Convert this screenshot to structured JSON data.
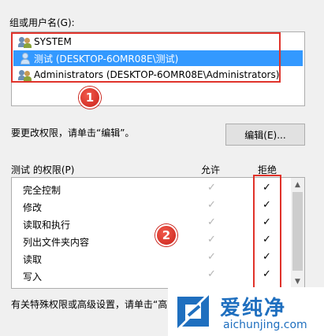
{
  "group_label": "组或用户名(G):",
  "users": [
    {
      "name": "SYSTEM",
      "icon": "group-icon",
      "selected": false
    },
    {
      "name": "测试 (DESKTOP-6OMR08E\\测试)",
      "icon": "user-icon",
      "selected": true
    },
    {
      "name": "Administrators (DESKTOP-6OMR08E\\Administrators)",
      "icon": "group-icon",
      "selected": false
    }
  ],
  "annotations": {
    "badge1": "1",
    "badge2": "2",
    "color": "#e0322a"
  },
  "change_hint": "要更改权限，请单击“编辑”。",
  "edit_button": "编辑(E)...",
  "permissions": {
    "title": "测试 的权限(P)",
    "col_allow": "允许",
    "col_deny": "拒绝",
    "rows": [
      {
        "name": "完全控制",
        "allow": "✓",
        "deny": "✓"
      },
      {
        "name": "修改",
        "allow": "✓",
        "deny": "✓"
      },
      {
        "name": "读取和执行",
        "allow": "✓",
        "deny": "✓"
      },
      {
        "name": "列出文件夹内容",
        "allow": "✓",
        "deny": "✓"
      },
      {
        "name": "读取",
        "allow": "✓",
        "deny": "✓"
      },
      {
        "name": "写入",
        "allow": "✓",
        "deny": "✓"
      }
    ]
  },
  "special_hint": "有关特殊权限或高级设置，请单击“高",
  "scroll": {
    "up": "▲",
    "down": "▼"
  },
  "watermark": {
    "cn": "爱纯净",
    "en": "aichunjing.com"
  },
  "colors": {
    "selection": "#3399ff",
    "brand": "#1f6fbf"
  }
}
